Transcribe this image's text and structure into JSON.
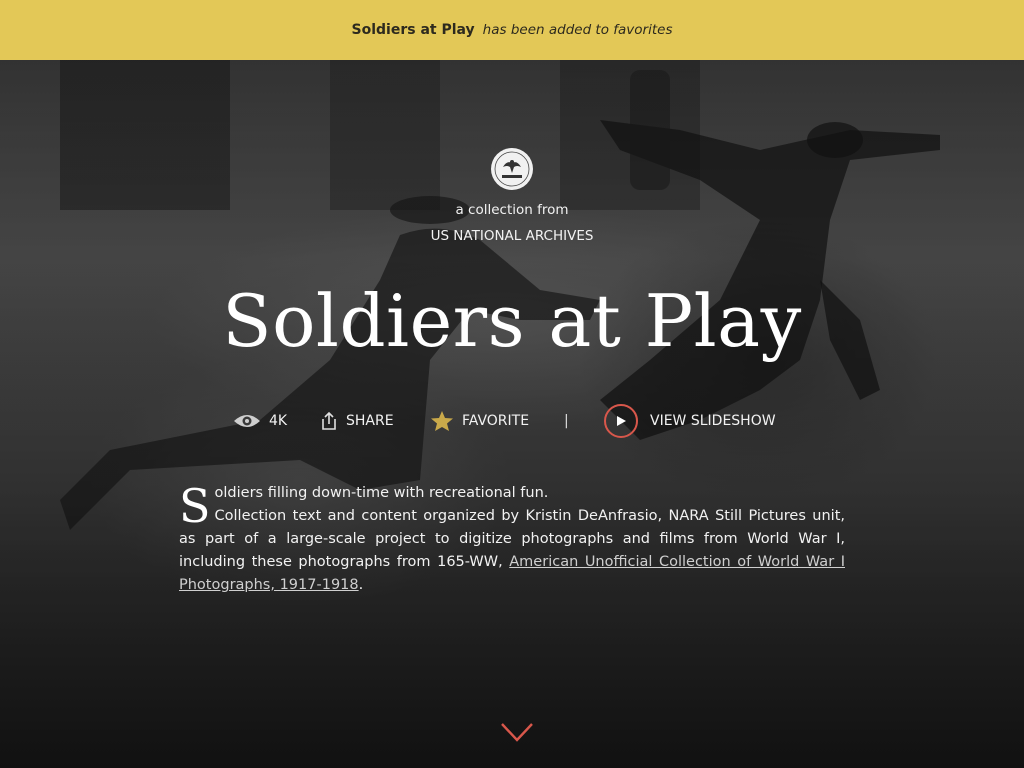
{
  "notification": {
    "collection_name": "Soldiers at Play",
    "message": "has been added to favorites"
  },
  "hero": {
    "from_label": "a collection from",
    "publisher": "US NATIONAL ARCHIVES",
    "logo_text": "NATIONAL ARCHIVES",
    "title": "Soldiers at Play"
  },
  "actions": {
    "views": "4K",
    "share": "SHARE",
    "favorite": "FAVORITE",
    "separator": "|",
    "slideshow": "VIEW SLIDESHOW"
  },
  "description": {
    "dropcap": "S",
    "line1_rest": "oldiers filling down-time with recreational fun.",
    "body": "Collection text and content organized by Kristin DeAnfrasio, NARA Still Pictures unit, as part of a large-scale project to digitize photographs and films from World War I, including these photographs from 165-WW, ",
    "link_text": "American Unofficial Collection of World War I Photographs, 1917-1918",
    "trailing": "."
  },
  "colors": {
    "notification_bg": "#e3c857",
    "accent": "#d8574b",
    "favorite_star": "#c9a94a"
  },
  "icons": {
    "views": "eye-icon",
    "share": "share-icon",
    "favorite": "star-icon",
    "slideshow": "play-icon",
    "scroll": "chevron-down-icon"
  }
}
